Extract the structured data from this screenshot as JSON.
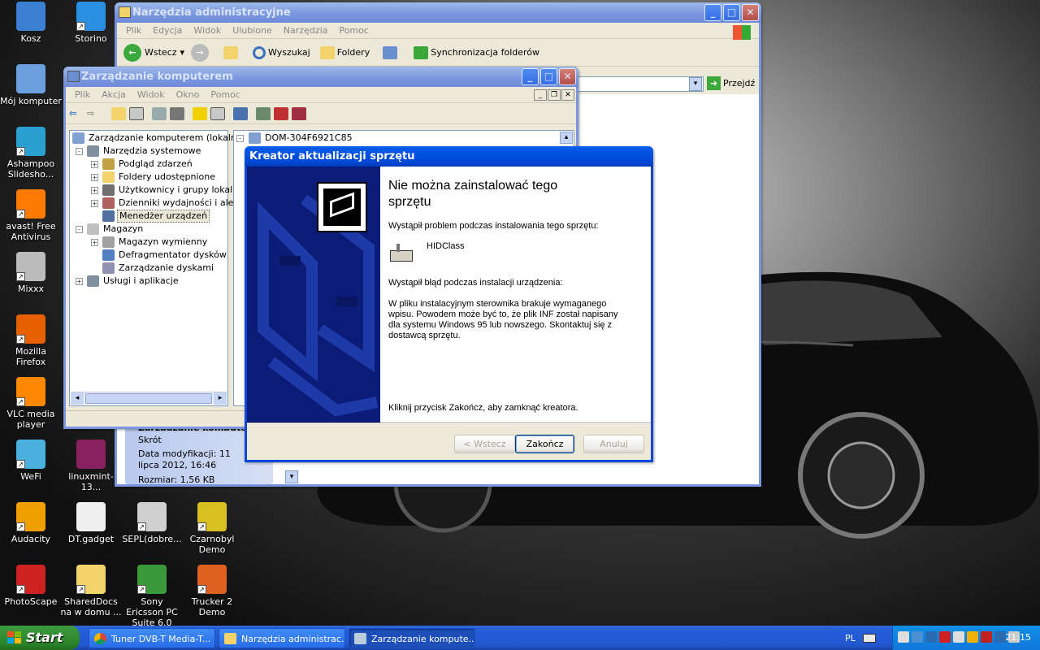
{
  "desktop": {
    "icons": [
      {
        "label": "Kosz",
        "color": "#3a7fd0"
      },
      {
        "label": "Storino",
        "color": "#2a8fe0"
      },
      {
        "label": "Mój komputer",
        "color": "#6aa0e0"
      },
      {
        "label": "Ashampoo Slidesho...",
        "color": "#2aa0d0"
      },
      {
        "label": "avast! Free Antivirus",
        "color": "#ff7a00"
      },
      {
        "label": "Mixxx",
        "color": "#bbbbbb"
      },
      {
        "label": "Mozilla Firefox",
        "color": "#e66000"
      },
      {
        "label": "VLC media player",
        "color": "#ff8800"
      },
      {
        "label": "WeFi",
        "color": "#4ab0e0"
      },
      {
        "label": "linuxmint-13...",
        "color": "#8b2060"
      },
      {
        "label": "Audacity",
        "color": "#f0a000"
      },
      {
        "label": "DT.gadget",
        "color": "#f0f0f0"
      },
      {
        "label": "SEPL(dobre...",
        "color": "#d0d0d0"
      },
      {
        "label": "Czarnobyl Demo",
        "color": "#d8c020"
      },
      {
        "label": "PhotoScape",
        "color": "#cc2222"
      },
      {
        "label": "SharedDocs na w domu ...",
        "color": "#f3d36b"
      },
      {
        "label": "Sony Ericsson PC Suite 6.0",
        "color": "#3a9a3a"
      },
      {
        "label": "Trucker 2 Demo",
        "color": "#e06020"
      }
    ]
  },
  "explorer": {
    "title": "Narzędzia administracyjne",
    "menu": [
      "Plik",
      "Edycja",
      "Widok",
      "Ulubione",
      "Narzędzia",
      "Pomoc"
    ],
    "back": "Wstecz",
    "search": "Wyszukaj",
    "folders": "Foldery",
    "sync": "Synchronizacja folderów",
    "go": "Przejdź",
    "details": {
      "title": "Zarządzanie komputerem",
      "type": "Skrót",
      "modified": "Data modyfikacji: 11 lipca 2012, 16:46",
      "size": "Rozmiar: 1,56 KB"
    }
  },
  "mmc": {
    "title": "Zarządzanie komputerem",
    "menu": [
      "Plik",
      "Akcja",
      "Widok",
      "Okno",
      "Pomoc"
    ],
    "tree": {
      "root": "Zarządzanie komputerem (lokalne)",
      "items": [
        {
          "label": "Narzędzia systemowe",
          "level": 1,
          "exp": "-"
        },
        {
          "label": "Podgląd zdarzeń",
          "level": 2,
          "exp": "+"
        },
        {
          "label": "Foldery udostępnione",
          "level": 2,
          "exp": "+"
        },
        {
          "label": "Użytkownicy i grupy lokalne",
          "level": 2,
          "exp": "+"
        },
        {
          "label": "Dzienniki wydajności i alerty",
          "level": 2,
          "exp": "+"
        },
        {
          "label": "Menedżer urządzeń",
          "level": 2,
          "exp": "",
          "selected": true
        },
        {
          "label": "Magazyn",
          "level": 1,
          "exp": "-"
        },
        {
          "label": "Magazyn wymienny",
          "level": 2,
          "exp": "+"
        },
        {
          "label": "Defragmentator dysków",
          "level": 2,
          "exp": ""
        },
        {
          "label": "Zarządzanie dyskami",
          "level": 2,
          "exp": ""
        },
        {
          "label": "Usługi i aplikacje",
          "level": 1,
          "exp": "+"
        }
      ]
    },
    "device_root": "DOM-304F6921C85"
  },
  "wizard": {
    "title": "Kreator aktualizacji sprzętu",
    "heading": "Nie można zainstalować tego sprzętu",
    "problem": "Wystąpił problem podczas instalowania tego sprzętu:",
    "device": "HIDClass",
    "error_title": "Wystąpił błąd podczas instalacji urządzenia:",
    "error_text": "W pliku instalacyjnym sterownika brakuje wymaganego wpisu. Powodem może być to, że plik INF został napisany dla systemu Windows 95 lub nowszego. Skontaktuj się z dostawcą sprzętu.",
    "finish_hint": "Kliknij przycisk Zakończ, aby zamknąć kreatora.",
    "btn_back": "< Wstecz",
    "btn_finish": "Zakończ",
    "btn_cancel": "Anuluj"
  },
  "taskbar": {
    "start": "Start",
    "items": [
      {
        "label": "Tuner DVB-T Media-T...",
        "icon": "chrome-icon"
      },
      {
        "label": "Narzędzia administrac...",
        "icon": "folder-icon"
      },
      {
        "label": "Zarządzanie kompute...",
        "icon": "computer-icon"
      }
    ],
    "lang": "PL",
    "clock": "21:15"
  }
}
